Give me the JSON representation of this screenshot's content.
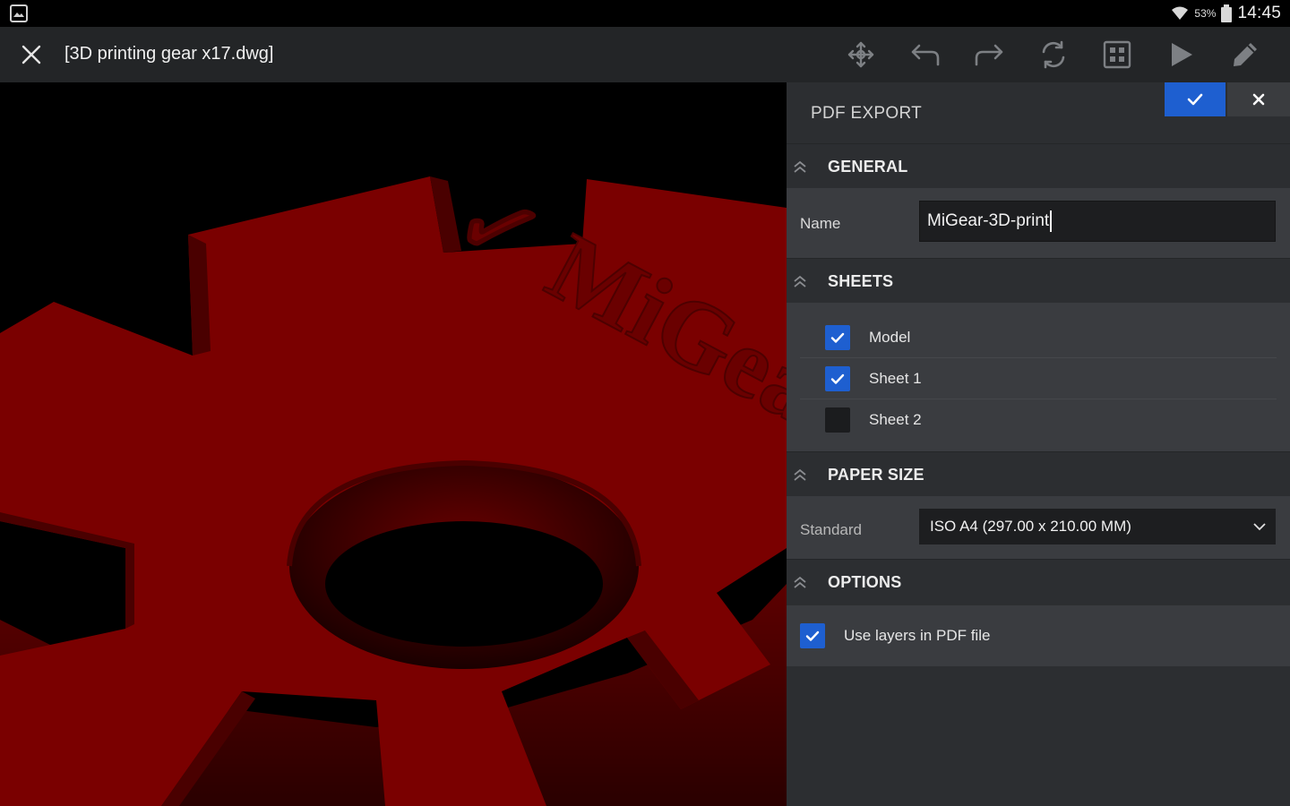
{
  "status_bar": {
    "battery": "53%",
    "time": "14:45",
    "icons": [
      "gallery-icon",
      "wifi-icon",
      "battery-icon"
    ]
  },
  "toolbar": {
    "title": "[3D printing gear x17.dwg]",
    "close_icon": "close-icon",
    "tools": [
      "move-icon",
      "undo-icon",
      "redo-icon",
      "rotate-icon",
      "grid-icon",
      "play-icon",
      "edit-icon"
    ]
  },
  "viewport": {
    "model_color": "#7a0000",
    "engraved_text": "✓ MiGear"
  },
  "panel": {
    "title": "PDF EXPORT",
    "accent": "#1e5fd0",
    "general": {
      "header": "GENERAL",
      "name_label": "Name",
      "name_value": "MiGear-3D-print"
    },
    "sheets": {
      "header": "SHEETS",
      "items": [
        {
          "label": "Model",
          "checked": true
        },
        {
          "label": "Sheet 1",
          "checked": true
        },
        {
          "label": "Sheet 2",
          "checked": false
        }
      ]
    },
    "paper_size": {
      "header": "PAPER SIZE",
      "standard_label": "Standard",
      "standard_value": "ISO A4 (297.00 x 210.00 MM)"
    },
    "options": {
      "header": "OPTIONS",
      "items": [
        {
          "label": "Use layers in PDF file",
          "checked": true
        }
      ]
    }
  }
}
